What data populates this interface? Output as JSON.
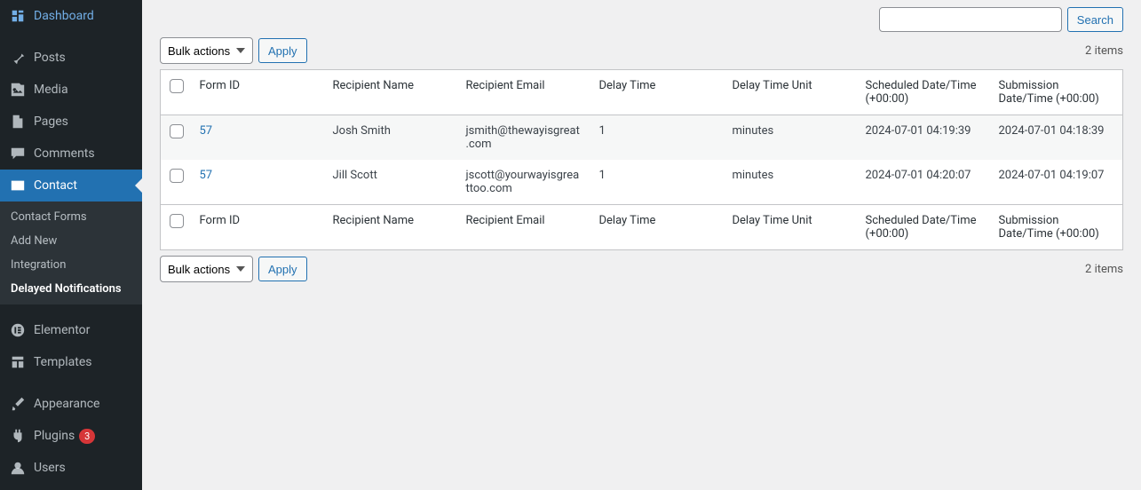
{
  "sidebar": {
    "items": [
      {
        "label": "Dashboard",
        "icon": "dashboard"
      },
      {
        "label": "Posts",
        "icon": "pin"
      },
      {
        "label": "Media",
        "icon": "media"
      },
      {
        "label": "Pages",
        "icon": "page"
      },
      {
        "label": "Comments",
        "icon": "comment"
      },
      {
        "label": "Contact",
        "icon": "mail"
      },
      {
        "label": "Elementor",
        "icon": "elementor"
      },
      {
        "label": "Templates",
        "icon": "templates"
      },
      {
        "label": "Appearance",
        "icon": "brush"
      },
      {
        "label": "Plugins",
        "icon": "plug"
      },
      {
        "label": "Users",
        "icon": "user"
      }
    ],
    "contact_sub": [
      {
        "label": "Contact Forms"
      },
      {
        "label": "Add New"
      },
      {
        "label": "Integration"
      },
      {
        "label": "Delayed Notifications"
      }
    ],
    "plugins_badge": "3"
  },
  "search": {
    "button": "Search"
  },
  "bulk": {
    "label": "Bulk actions",
    "apply": "Apply"
  },
  "count_label": "2 items",
  "table": {
    "headers": {
      "form_id": "Form ID",
      "recipient_name": "Recipient Name",
      "recipient_email": "Recipient Email",
      "delay_time": "Delay Time",
      "delay_unit": "Delay Time Unit",
      "scheduled": "Scheduled Date/Time (+00:00)",
      "submission": "Submission Date/Time (+00:00)"
    },
    "rows": [
      {
        "form_id": "57",
        "recipient_name": "Josh Smith",
        "recipient_email": "jsmith@thewayisgreat.com",
        "delay_time": "1",
        "delay_unit": "minutes",
        "scheduled": "2024-07-01 04:19:39",
        "submission": "2024-07-01 04:18:39"
      },
      {
        "form_id": "57",
        "recipient_name": "Jill Scott",
        "recipient_email": "jscott@yourwayisgreattoo.com",
        "delay_time": "1",
        "delay_unit": "minutes",
        "scheduled": "2024-07-01 04:20:07",
        "submission": "2024-07-01 04:19:07"
      }
    ]
  }
}
